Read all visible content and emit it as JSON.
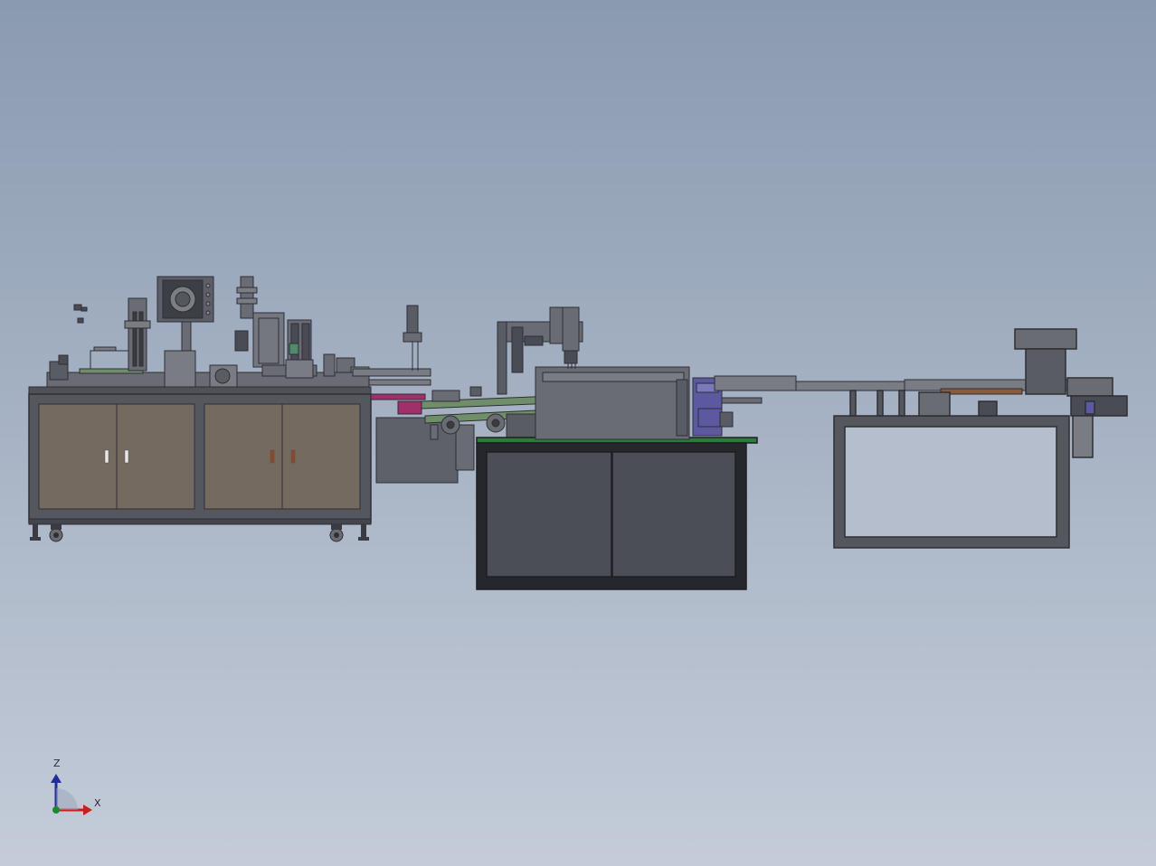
{
  "viewport": {
    "background_top": "#8a9ab0",
    "background_bottom": "#c4ccd9"
  },
  "triad": {
    "z_label": "Z",
    "x_label": "X",
    "z_color": "#1f2f9a",
    "x_color": "#c8201c",
    "origin_color": "#1a8a2a"
  },
  "colors": {
    "frame": "#4a4c55",
    "cabinet_panel": "#756a5f",
    "cabinet_panel_dark": "#4b4d57",
    "green_part": "#6f8f6a",
    "purple_part": "#5b5aa0",
    "magenta_part": "#a0306a",
    "brown_part": "#8a5a3a"
  },
  "parts": [
    {
      "name": "machine-1-left-cabinet"
    },
    {
      "name": "machine-1-monitor"
    },
    {
      "name": "machine-2-center-cabinet"
    },
    {
      "name": "machine-3-right-frame"
    },
    {
      "name": "vibratory-bowl-feeder"
    },
    {
      "name": "conveyor-line"
    }
  ]
}
